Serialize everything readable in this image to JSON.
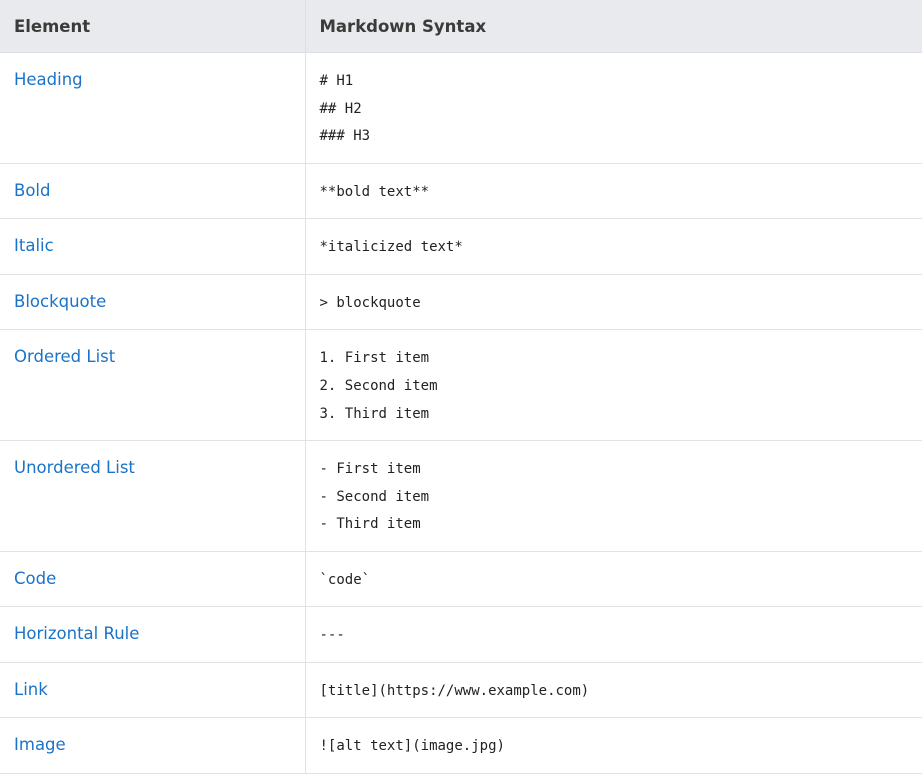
{
  "table": {
    "headers": {
      "element": "Element",
      "syntax": "Markdown Syntax"
    },
    "rows": [
      {
        "element": "Heading",
        "syntax": [
          "# H1",
          "## H2",
          "### H3"
        ]
      },
      {
        "element": "Bold",
        "syntax": [
          "**bold text**"
        ]
      },
      {
        "element": "Italic",
        "syntax": [
          "*italicized text*"
        ]
      },
      {
        "element": "Blockquote",
        "syntax": [
          "> blockquote"
        ]
      },
      {
        "element": "Ordered List",
        "syntax": [
          "1. First item",
          "2. Second item",
          "3. Third item"
        ]
      },
      {
        "element": "Unordered List",
        "syntax": [
          "- First item",
          "- Second item",
          "- Third item"
        ]
      },
      {
        "element": "Code",
        "syntax": [
          "`code`"
        ]
      },
      {
        "element": "Horizontal Rule",
        "syntax": [
          "---"
        ]
      },
      {
        "element": "Link",
        "syntax": [
          "[title](https://www.example.com)"
        ]
      },
      {
        "element": "Image",
        "syntax": [
          "![alt text](image.jpg)"
        ]
      }
    ]
  },
  "colors": {
    "link": "#1a73c8",
    "header_bg": "#e8eaed",
    "border": "#e0e3e6"
  }
}
